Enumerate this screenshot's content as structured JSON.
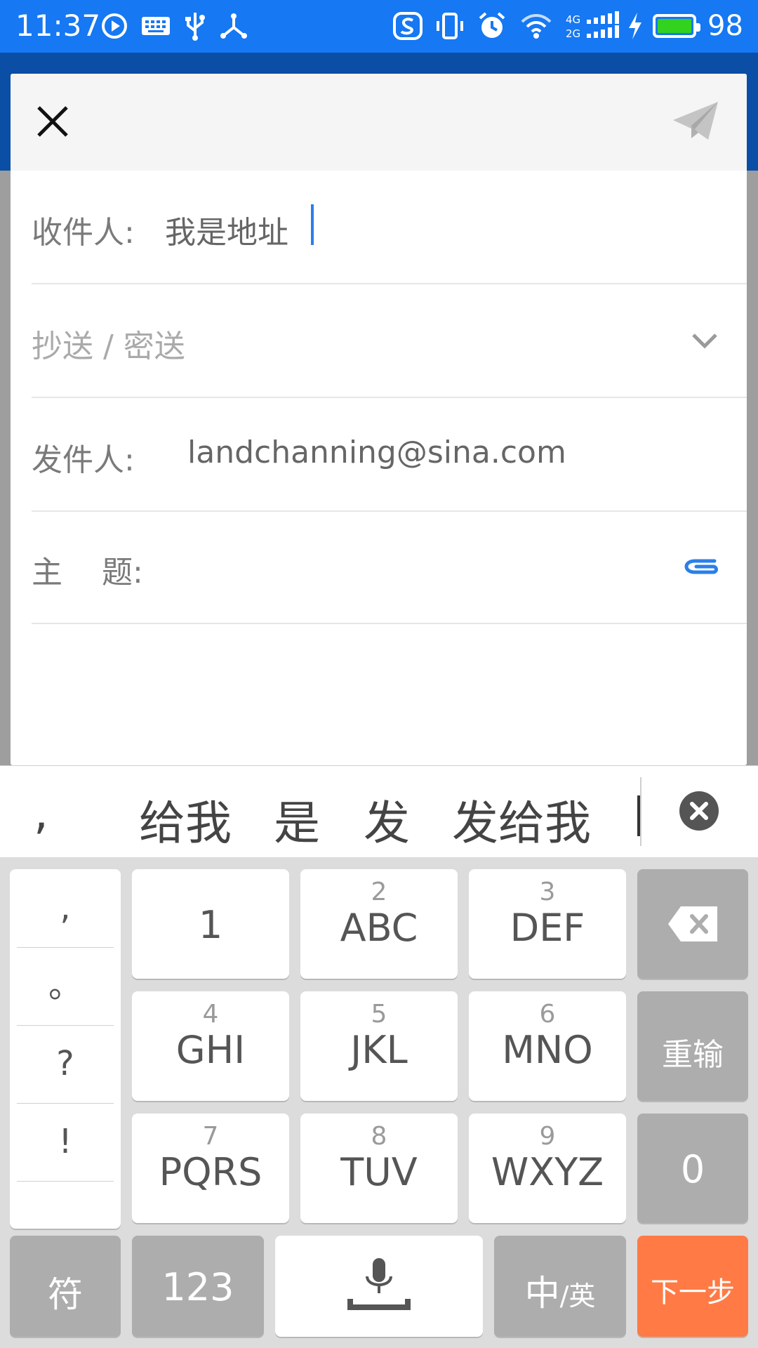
{
  "status_bar": {
    "time": "11:37",
    "battery_level": "98",
    "network_4g": "4G",
    "network_2g": "2G"
  },
  "compose": {
    "to_label": "收件人:",
    "to_value": "我是地址",
    "cc_bcc_placeholder": "抄送 / 密送",
    "from_label": "发件人:",
    "from_value": "landchanning@sina.com",
    "subject_label": "主    题:"
  },
  "keyboard": {
    "candidates": [
      ",",
      "给我",
      "是",
      "发",
      "发给我"
    ],
    "punctuation": [
      ",",
      "。",
      "?",
      "!"
    ],
    "keys": [
      {
        "num": "",
        "letters": "1"
      },
      {
        "num": "2",
        "letters": "ABC"
      },
      {
        "num": "3",
        "letters": "DEF"
      },
      {
        "num": "4",
        "letters": "GHI"
      },
      {
        "num": "5",
        "letters": "JKL"
      },
      {
        "num": "6",
        "letters": "MNO"
      },
      {
        "num": "7",
        "letters": "PQRS"
      },
      {
        "num": "8",
        "letters": "TUV"
      },
      {
        "num": "9",
        "letters": "WXYZ"
      }
    ],
    "retype_label": "重输",
    "zero_label": "0",
    "symbol_label": "符",
    "numeric_label": "123",
    "lang_main": "中",
    "lang_alt": "/英",
    "next_label": "下一步"
  },
  "colors": {
    "status_bar": "#1678f2",
    "accent": "#2b7fe8",
    "next_key": "#ff7a45",
    "battery": "#33d21f"
  }
}
